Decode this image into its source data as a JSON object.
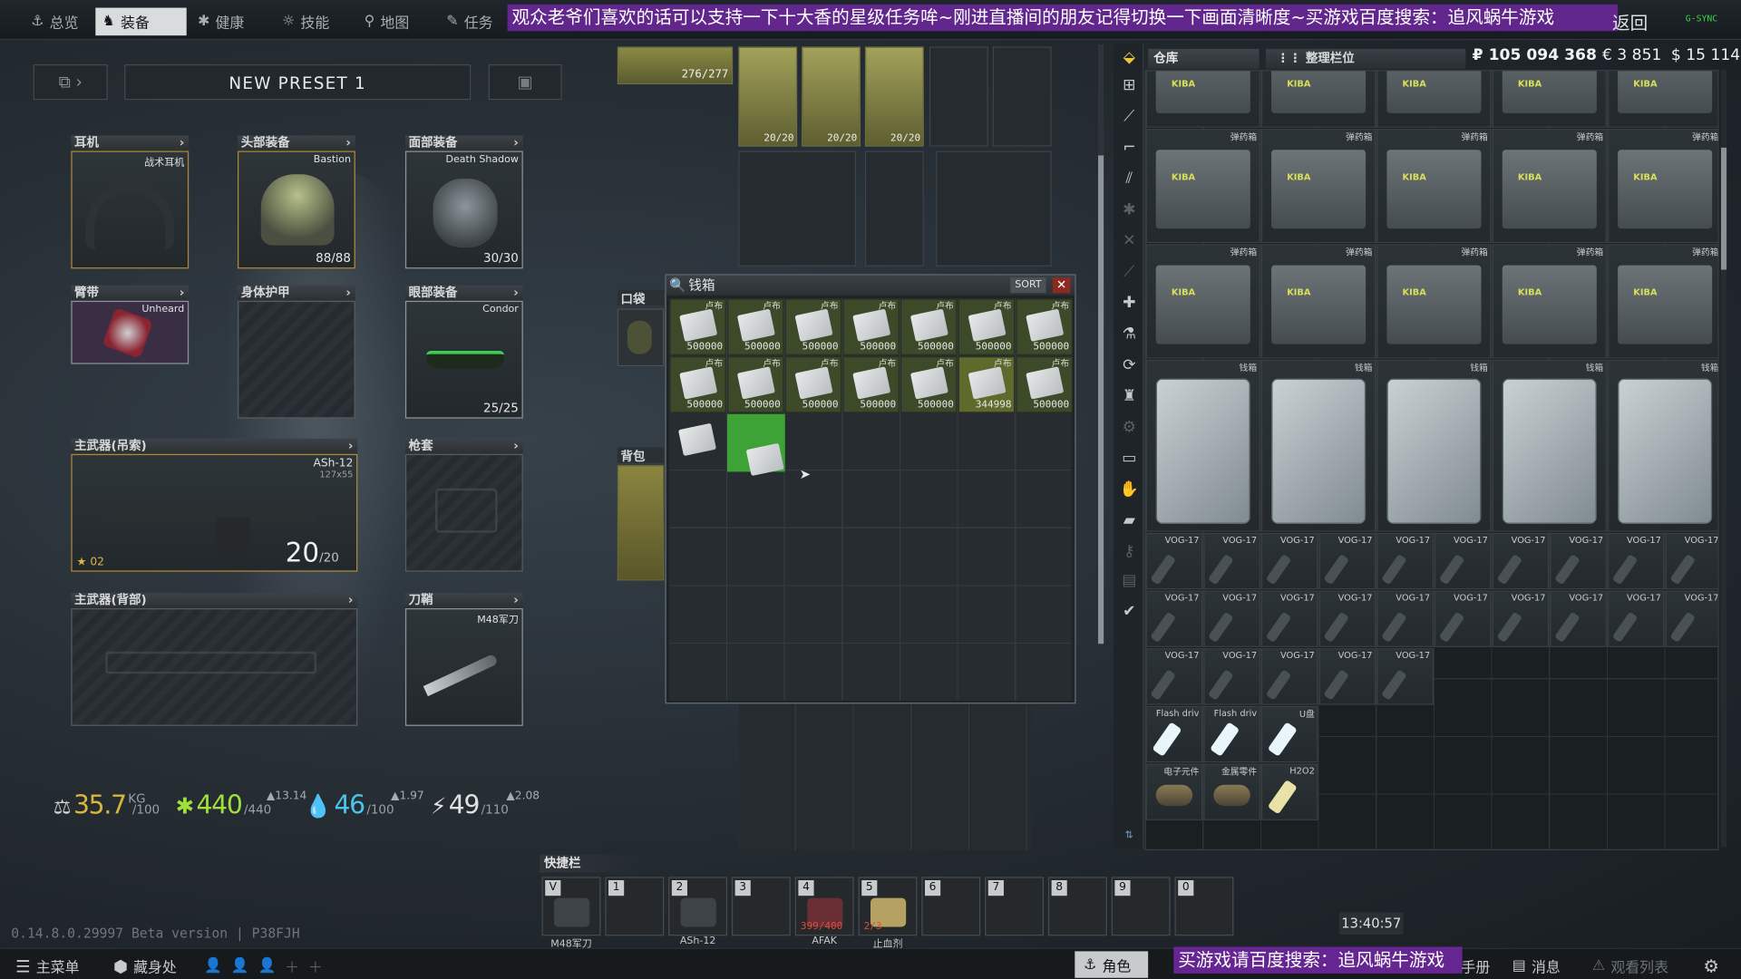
{
  "nav": {
    "items": [
      {
        "icon": "anchor-icon",
        "label": "总览"
      },
      {
        "icon": "gear-figure-icon",
        "label": "装备"
      },
      {
        "icon": "health-icon",
        "label": "健康"
      },
      {
        "icon": "skill-icon",
        "label": "技能"
      },
      {
        "icon": "map-pin-icon",
        "label": "地图"
      },
      {
        "icon": "task-icon",
        "label": "任务"
      }
    ],
    "back_label": "返回",
    "brand": "G-SYNC",
    "banner": "观众老爷们喜欢的话可以支持一下十大香的星级任务哞~刚进直播间的朋友记得切换一下画面清晰度~买游戏百度搜索：追风蜗牛游戏"
  },
  "preset": {
    "name": "NEW PRESET 1"
  },
  "slots": {
    "earpiece": {
      "title": "耳机",
      "item": "战术耳机"
    },
    "headwear": {
      "title": "头部装备",
      "item": "Bastion",
      "durability": "88/88"
    },
    "face_cover": {
      "title": "面部装备",
      "item": "Death Shadow",
      "durability": "30/30"
    },
    "armband": {
      "title": "臂带",
      "item": "Unheard"
    },
    "body_armor": {
      "title": "身体护甲"
    },
    "eyewear": {
      "title": "眼部装备",
      "item": "Condor",
      "durability": "25/25"
    },
    "primary_sling": {
      "title": "主武器(吊索)",
      "item": "ASh-12",
      "caliber": "127x55",
      "ammo": "20",
      "ammo_max": "/20",
      "level": "02"
    },
    "holster": {
      "title": "枪套"
    },
    "primary_back": {
      "title": "主武器(背部)"
    },
    "scabbard": {
      "title": "刀鞘",
      "item": "M48军刀"
    },
    "pockets": {
      "title": "口袋"
    },
    "backpack": {
      "title": "背包"
    }
  },
  "stats": {
    "weight": {
      "value": "35.7",
      "unit": "KG",
      "max": "/100"
    },
    "health": {
      "value": "440",
      "max": "/440",
      "regen": "▲13.14"
    },
    "hydration": {
      "value": "46",
      "max": "/100",
      "rate": "▲1.97"
    },
    "energy": {
      "value": "49",
      "max": "/110",
      "rate": "▲2.08"
    }
  },
  "rig": {
    "counter": "276/277",
    "mags": [
      "20/20",
      "20/20",
      "20/20"
    ]
  },
  "wallet": {
    "title": "钱箱",
    "sort_label": "SORT",
    "item_label": "卢布",
    "counts": [
      "500000",
      "500000",
      "500000",
      "500000",
      "500000",
      "500000",
      "500000",
      "500000",
      "500000",
      "500000",
      "500000",
      "500000",
      "344998",
      "500000"
    ]
  },
  "stash": {
    "tab_label": "仓库",
    "sort_tab_label": "整理栏位",
    "rubles": "₽ 105 094 368",
    "euros": "€ 3 851",
    "dollars": "$ 15 114",
    "ammo_box_label": "弹药箱",
    "kiba_label": "KIBA",
    "wallet_label": "钱箱",
    "vog_label": "VOG-17",
    "misc_items": [
      {
        "label": "Flash driv",
        "kind": "flash"
      },
      {
        "label": "Flash driv",
        "kind": "flash"
      },
      {
        "label": "U盘",
        "kind": "flash"
      },
      {
        "label": "电子元件",
        "kind": "parts"
      },
      {
        "label": "金属零件",
        "kind": "parts"
      },
      {
        "label": "H2O2",
        "kind": "bottle"
      }
    ]
  },
  "quickbar": {
    "title": "快捷栏",
    "slots": [
      {
        "key": "V",
        "label": "M48军刀",
        "sub": ""
      },
      {
        "key": "1",
        "label": "",
        "sub": ""
      },
      {
        "key": "2",
        "label": "ASh-12",
        "sub": ""
      },
      {
        "key": "3",
        "label": "",
        "sub": ""
      },
      {
        "key": "4",
        "label": "AFAK",
        "sub": "399/400"
      },
      {
        "key": "5",
        "label": "止血剂",
        "sub": "2/3"
      },
      {
        "key": "6",
        "label": "",
        "sub": ""
      },
      {
        "key": "7",
        "label": "",
        "sub": ""
      },
      {
        "key": "8",
        "label": "",
        "sub": ""
      },
      {
        "key": "9",
        "label": "",
        "sub": ""
      },
      {
        "key": "0",
        "label": "",
        "sub": ""
      }
    ]
  },
  "footer": {
    "version": "0.14.8.0.29997 Beta version | P38FJH",
    "clock": "13:40:57",
    "main_menu": "主菜单",
    "hideout": "藏身处",
    "character": "角色",
    "handbook": "手册",
    "messages": "消息",
    "watchlist": "观看列表",
    "banner": "买游戏请百度搜索：追风蜗牛游戏"
  }
}
